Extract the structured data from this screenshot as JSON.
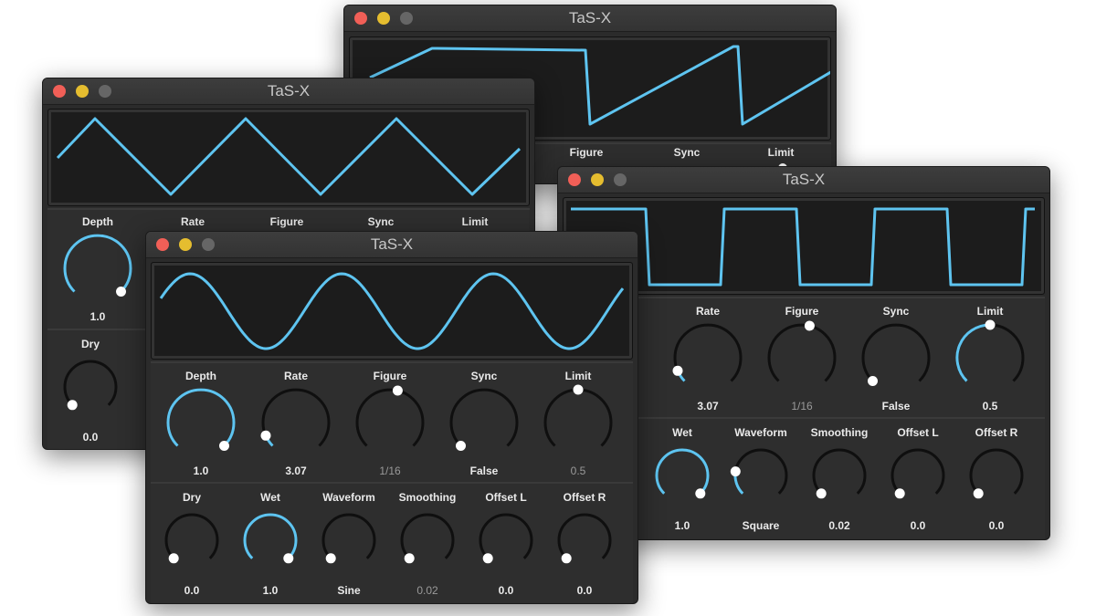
{
  "colors": {
    "accent": "#5ec4f0",
    "arc_off": "#0f0f0f",
    "handle": "#ffffff",
    "scope_bg": "#1c1c1c"
  },
  "windows": [
    {
      "id": "sawtooth",
      "title": "TaS-X",
      "waveform": "sawtooth",
      "top_row": [
        {
          "label": "Figure"
        },
        {
          "label": "Sync"
        },
        {
          "label": "Limit"
        }
      ]
    },
    {
      "id": "triangle",
      "title": "TaS-X",
      "waveform": "triangle",
      "top_row": [
        {
          "label": "Depth",
          "value": "1.0",
          "level": 1.0,
          "active": true
        },
        {
          "label": "Rate"
        },
        {
          "label": "Figure"
        },
        {
          "label": "Sync"
        },
        {
          "label": "Limit"
        }
      ],
      "bottom_row": [
        {
          "label": "Dry",
          "value": "0.0",
          "level": 0.0,
          "active": false
        }
      ]
    },
    {
      "id": "square",
      "title": "TaS-X",
      "waveform": "square",
      "top_row": [
        {
          "label": "Rate",
          "value": "3.07",
          "level": 0.08,
          "active": true
        },
        {
          "label": "Figure",
          "value": "1/16",
          "level": 0.55,
          "active": false,
          "dim": true
        },
        {
          "label": "Sync",
          "value": "False",
          "level": 0.0,
          "active": false
        },
        {
          "label": "Limit",
          "value": "0.5",
          "level": 0.5,
          "active": true
        }
      ],
      "bottom_row": [
        {
          "label": "Wet",
          "value": "1.0",
          "level": 1.0,
          "active": true
        },
        {
          "label": "Waveform",
          "value": "Square",
          "level": 0.2,
          "active": true
        },
        {
          "label": "Smoothing",
          "value": "0.02",
          "level": 0.0,
          "active": false
        },
        {
          "label": "Offset L",
          "value": "0.0",
          "level": 0.0,
          "active": false
        },
        {
          "label": "Offset R",
          "value": "0.0",
          "level": 0.0,
          "active": false
        }
      ]
    },
    {
      "id": "sine",
      "title": "TaS-X",
      "waveform": "sine",
      "top_row": [
        {
          "label": "Depth",
          "value": "1.0",
          "level": 1.0,
          "active": true
        },
        {
          "label": "Rate",
          "value": "3.07",
          "level": 0.08,
          "active": true
        },
        {
          "label": "Figure",
          "value": "1/16",
          "level": 0.55,
          "active": false,
          "dim": true
        },
        {
          "label": "Sync",
          "value": "False",
          "level": 0.0,
          "active": false
        },
        {
          "label": "Limit",
          "value": "0.5",
          "level": 0.5,
          "active": false,
          "dim": true
        }
      ],
      "bottom_row": [
        {
          "label": "Dry",
          "value": "0.0",
          "level": 0.0,
          "active": false
        },
        {
          "label": "Wet",
          "value": "1.0",
          "level": 1.0,
          "active": true
        },
        {
          "label": "Waveform",
          "value": "Sine",
          "level": 0.0,
          "active": false
        },
        {
          "label": "Smoothing",
          "value": "0.02",
          "level": 0.0,
          "active": false,
          "dim": true
        },
        {
          "label": "Offset L",
          "value": "0.0",
          "level": 0.0,
          "active": false
        },
        {
          "label": "Offset R",
          "value": "0.0",
          "level": 0.0,
          "active": false
        }
      ]
    }
  ]
}
